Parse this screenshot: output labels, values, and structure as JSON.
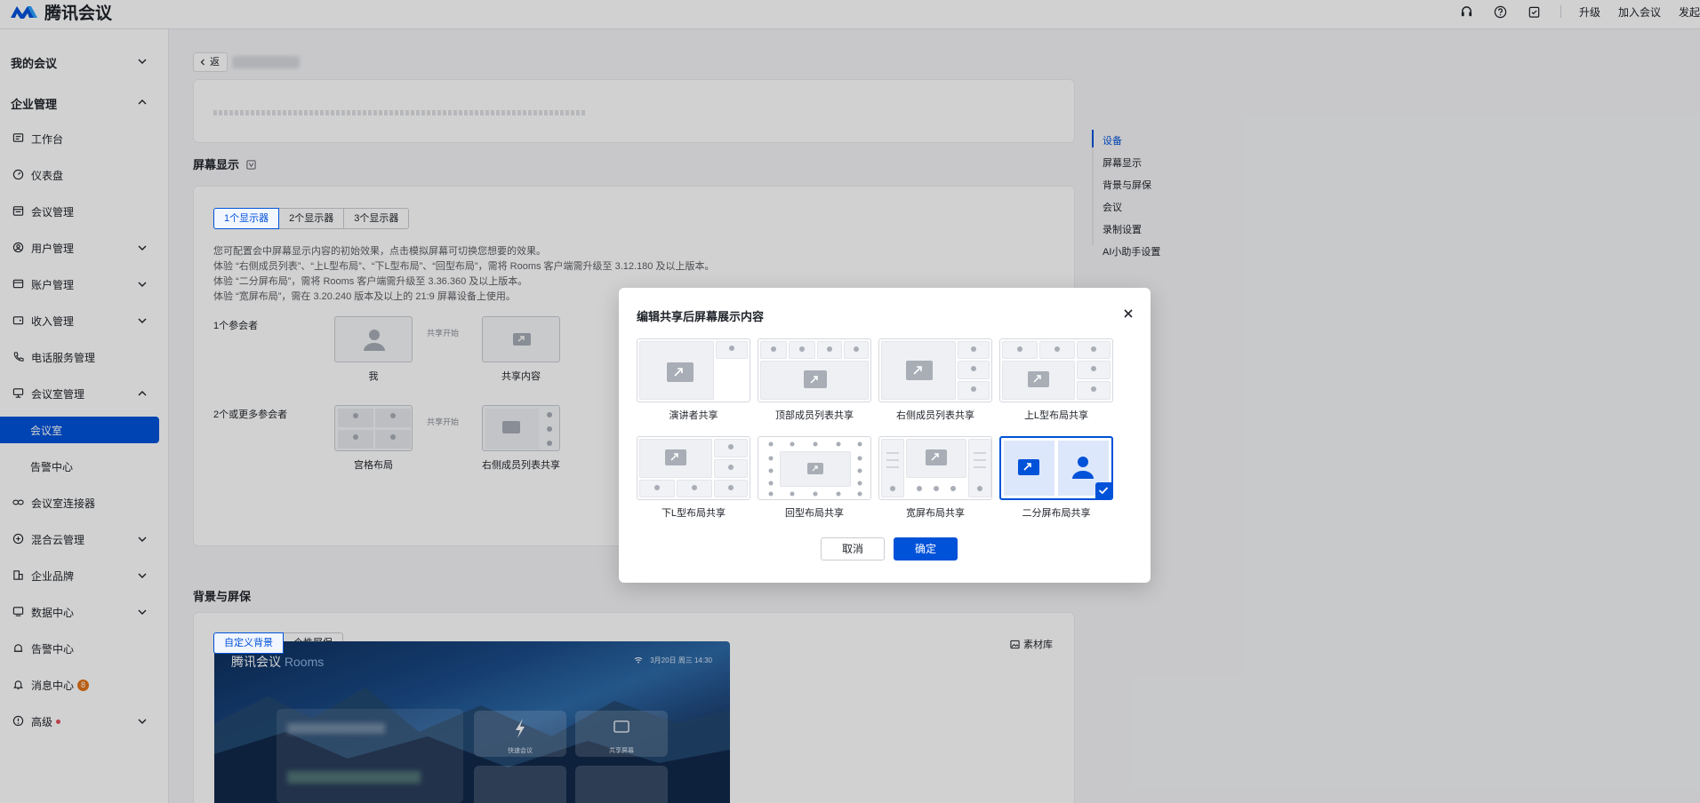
{
  "app": {
    "name": "腾讯会议"
  },
  "topbar": {
    "links": [
      "升级",
      "加入会议",
      "发起"
    ],
    "icons": [
      "headset-icon",
      "help-icon",
      "task-icon"
    ]
  },
  "sidebar": {
    "groups": [
      {
        "label": "我的会议",
        "expanded": false
      },
      {
        "label": "企业管理",
        "expanded": true
      }
    ],
    "items": [
      {
        "label": "工作台",
        "icon": "workbench-icon"
      },
      {
        "label": "仪表盘",
        "icon": "dashboard-icon"
      },
      {
        "label": "会议管理",
        "icon": "meeting-list-icon"
      },
      {
        "label": "用户管理",
        "icon": "user-icon"
      },
      {
        "label": "账户管理",
        "icon": "account-icon"
      },
      {
        "label": "收入管理",
        "icon": "wallet-icon"
      },
      {
        "label": "电话服务管理",
        "icon": "phone-icon"
      },
      {
        "label": "会议室管理",
        "icon": "room-icon"
      },
      {
        "label": "会议室",
        "active": true
      },
      {
        "label": "告警中心"
      },
      {
        "label": "会议室连接器",
        "icon": "link-icon"
      },
      {
        "label": "混合云管理",
        "icon": "cloud-icon"
      },
      {
        "label": "企业品牌",
        "icon": "brand-icon"
      },
      {
        "label": "数据中心",
        "icon": "data-icon"
      },
      {
        "label": "告警中心",
        "icon": "alarm-icon"
      },
      {
        "label": "消息中心",
        "icon": "bell-icon",
        "badge": "8"
      },
      {
        "label": "高级",
        "icon": "advanced-icon"
      }
    ]
  },
  "main": {
    "back_label": "返",
    "screen_section": {
      "title": "屏幕显示",
      "tabs": [
        "1个显示器",
        "2个显示器",
        "3个显示器"
      ],
      "desc": [
        "您可配置会中屏幕显示内容的初始效果，点击模拟屏幕可切换您想要的效果。",
        "体验 “右侧成员列表”、“上L型布局”、“下L型布局”、“回型布局”，需将 Rooms 客户端需升级至 3.12.180 及以上版本。",
        "体验 “二分屏布局”，需将 Rooms 客户端需升级至 3.36.360 及以上版本。",
        "体验 “宽屏布局”，需在 3.20.240 版本及以上的 21:9 屏幕设备上使用。"
      ],
      "row1_label": "1个参会者",
      "row2_label": "2个或更多参会者",
      "arrow_text": "共享开始",
      "thumbs": [
        "我",
        "共享内容",
        "宫格布局",
        "右侧成员列表共享"
      ]
    },
    "bg_section": {
      "title": "背景与屏保",
      "tabs": [
        "自定义背景",
        "个性屏保"
      ],
      "library": "素材库",
      "preview_brand": "腾讯会议",
      "preview_brand_suffix": "Rooms",
      "preview_status": "3月20日 周三 14:30",
      "preview_tiles": [
        "快速会议",
        "共享屏幕"
      ]
    }
  },
  "anchors": [
    "设备",
    "屏幕显示",
    "背景与屏保",
    "会议",
    "录制设置",
    "AI小助手设置"
  ],
  "modal": {
    "title": "编辑共享后屏幕展示内容",
    "options": [
      "演讲者共享",
      "顶部成员列表共享",
      "右侧成员列表共享",
      "上L型布局共享",
      "下L型布局共享",
      "回型布局共享",
      "宽屏布局共享",
      "二分屏布局共享"
    ],
    "selected_index": 7,
    "cancel": "取消",
    "confirm": "确定"
  },
  "colors": {
    "accent": "#0052d9"
  }
}
